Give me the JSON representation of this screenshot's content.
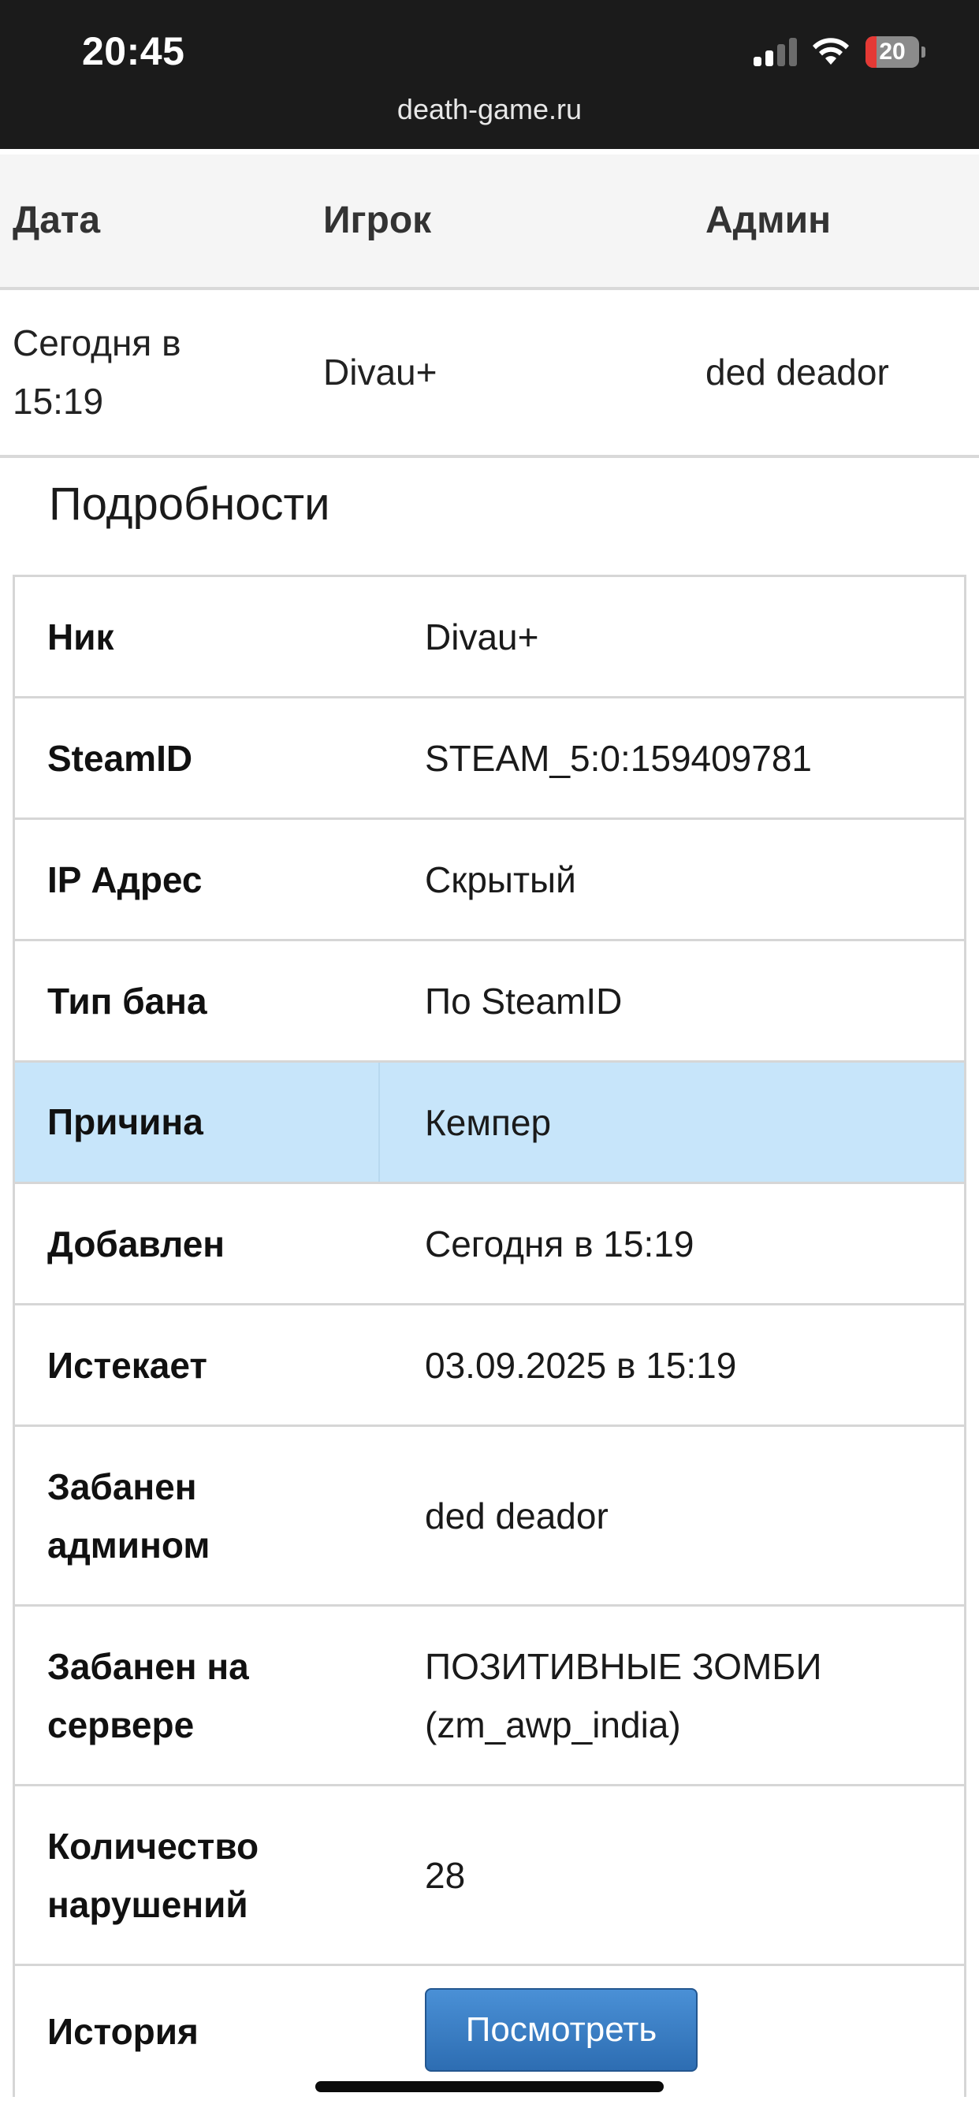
{
  "status_bar": {
    "time": "20:45",
    "battery_percent": "20",
    "battery_level": 0.2,
    "signal_bars_active": 2,
    "signal_bars_total": 4,
    "icons": [
      "cellular-signal-icon",
      "wifi-icon",
      "battery-icon"
    ],
    "colors": {
      "battery_low": "#e53935"
    }
  },
  "browser": {
    "url": "death-game.ru"
  },
  "list": {
    "headers": [
      "Дата",
      "Игрок",
      "Админ"
    ],
    "row": {
      "date_line1": "Сегодня в",
      "date_line2": "15:19",
      "player": "Divau+",
      "admin": "ded deador"
    }
  },
  "details": {
    "title": "Подробности",
    "rows": [
      {
        "label": "Ник",
        "value": "Divau+"
      },
      {
        "label": "SteamID",
        "value": "STEAM_5:0:159409781"
      },
      {
        "label": "IP Адрес",
        "value": "Скрытый"
      },
      {
        "label": "Тип бана",
        "value": "По SteamID"
      },
      {
        "label": "Причина",
        "value": "Кемпер"
      },
      {
        "label": "Добавлен",
        "value": "Сегодня в 15:19"
      },
      {
        "label": "Истекает",
        "value": "03.09.2025 в 15:19"
      },
      {
        "label_line1": "Забанен",
        "label_line2": "админом",
        "value": "ded deador"
      },
      {
        "label_line1": "Забанен на",
        "label_line2": "сервере",
        "value_line1": "ПОЗИТИВНЫЕ ЗОМБИ",
        "value_line2": "(zm_awp_india)"
      },
      {
        "label_line1": "Количество",
        "label_line2": "нарушений",
        "value": "28"
      },
      {
        "label": "История",
        "button": "Посмотреть"
      }
    ],
    "colors": {
      "highlight_row": "#c7e5fa",
      "button": "#3a7dc4"
    }
  }
}
